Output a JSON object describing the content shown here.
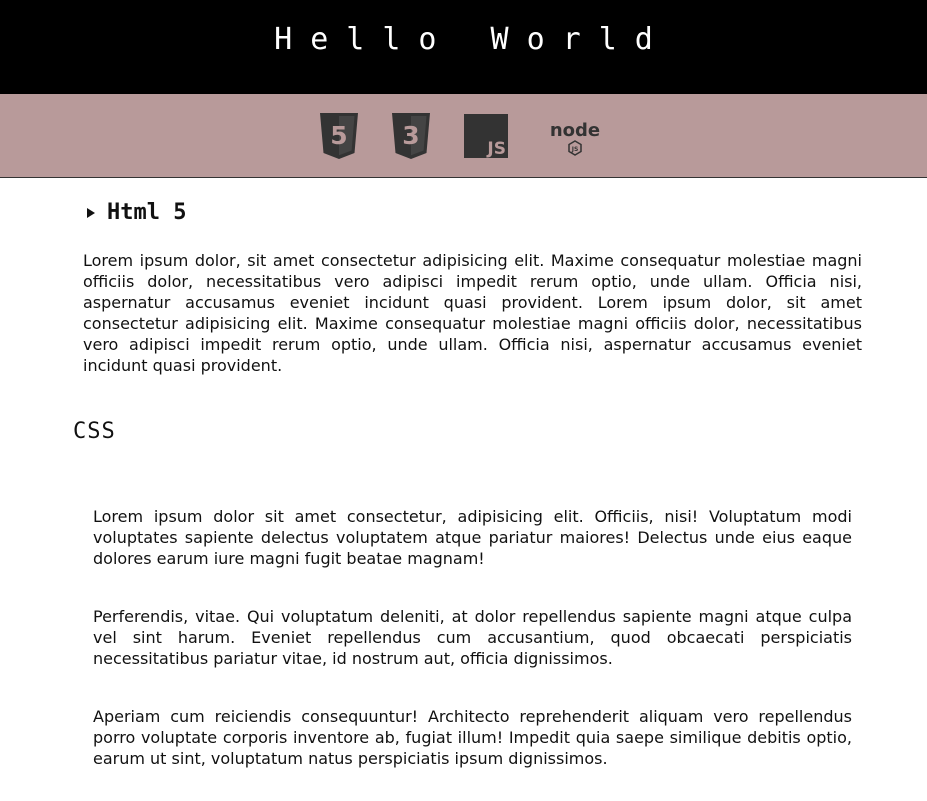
{
  "header": {
    "title": "Hello World"
  },
  "logos": [
    {
      "icon": "html5-icon",
      "label": "5"
    },
    {
      "icon": "css3-icon",
      "label": "3"
    },
    {
      "icon": "js-icon",
      "label": "JS"
    },
    {
      "icon": "nodejs-icon",
      "label": "node"
    }
  ],
  "html_section": {
    "heading": "Html 5",
    "paragraph": "Lorem ipsum dolor, sit amet consectetur adipisicing elit. Maxime consequatur molestiae magni officiis dolor, necessitatibus vero adipisci impedit rerum optio, unde ullam. Officia nisi, aspernatur accusamus eveniet incidunt quasi provident. Lorem ipsum dolor, sit amet consectetur adipisicing elit. Maxime consequatur molestiae magni officiis dolor, necessitatibus vero adipisci impedit rerum optio, unde ullam. Officia nisi, aspernatur accusamus eveniet incidunt quasi provident."
  },
  "css_section": {
    "heading": "CSS",
    "paragraphs": [
      "Lorem ipsum dolor sit amet consectetur, adipisicing elit. Officiis, nisi! Voluptatum modi voluptates sapiente delectus voluptatem atque pariatur maiores! Delectus unde eius eaque dolores earum iure magni fugit beatae magnam!",
      "Perferendis, vitae. Qui voluptatum deleniti, at dolor repellendus sapiente magni atque culpa vel sint harum. Eveniet repellendus cum accusantium, quod obcaecati perspiciatis necessitatibus pariatur vitae, id nostrum aut, officia dignissimos.",
      "Aperiam cum reiciendis consequuntur! Architecto reprehenderit aliquam vero repellendus porro voluptate corporis inventore ab, fugiat illum! Impedit quia saepe similique debitis optio, earum ut sint, voluptatum natus perspiciatis ipsum dignissimos."
    ]
  },
  "colors": {
    "header_bg": "#000000",
    "logo_bar_bg": "#b89a9a",
    "logo_fill": "#333333"
  }
}
